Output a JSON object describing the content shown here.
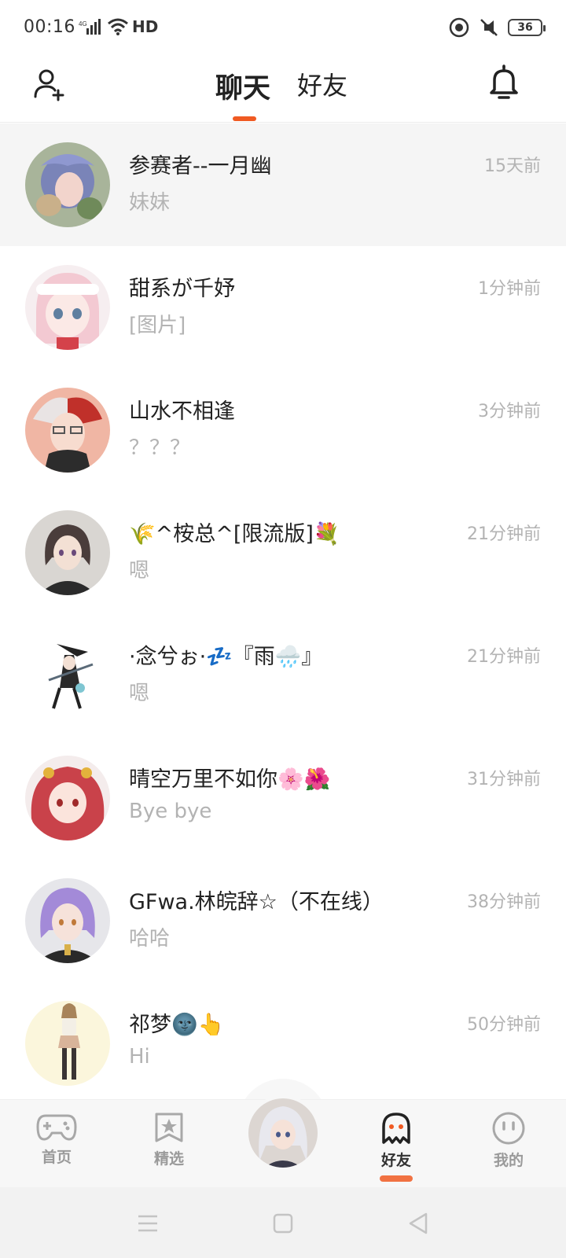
{
  "status_bar": {
    "time": "00:16",
    "network": "HD",
    "battery": "36"
  },
  "header": {
    "tabs": [
      {
        "label": "聊天",
        "active": true
      },
      {
        "label": "好友",
        "active": false
      }
    ],
    "add_friend_icon": "add-user-icon",
    "notification_icon": "bell-icon",
    "accent_color": "#f05a22"
  },
  "chats": [
    {
      "name": "参赛者--一月幽",
      "message": "妹妹",
      "time": "15天前",
      "pinned": true
    },
    {
      "name": "甜系が千妤",
      "message": "[图片]",
      "time": "1分钟前"
    },
    {
      "name": "山水不相逢",
      "message": "？？？",
      "time": "3分钟前"
    },
    {
      "name": "🌾^桉总^[限流版]💐",
      "message": "嗯",
      "time": "21分钟前"
    },
    {
      "name": "·念兮ぉ·💤『雨🌧️』",
      "message": "嗯",
      "time": "21分钟前"
    },
    {
      "name": "晴空万里不如你🌸🌺",
      "message": "Bye bye",
      "time": "31分钟前"
    },
    {
      "name": "GFwa.林皖辞☆（不在线）",
      "message": "哈哈",
      "time": "38分钟前"
    },
    {
      "name": "祁梦🌚👆",
      "message": "Hi",
      "time": "50分钟前"
    }
  ],
  "bottom_nav": {
    "items": [
      {
        "label": "首页",
        "icon": "gamepad-icon"
      },
      {
        "label": "精选",
        "icon": "star-bookmark-icon"
      },
      {
        "label": "好友",
        "icon": "ghost-icon",
        "active": true
      },
      {
        "label": "我的",
        "icon": "smiley-icon"
      }
    ]
  }
}
